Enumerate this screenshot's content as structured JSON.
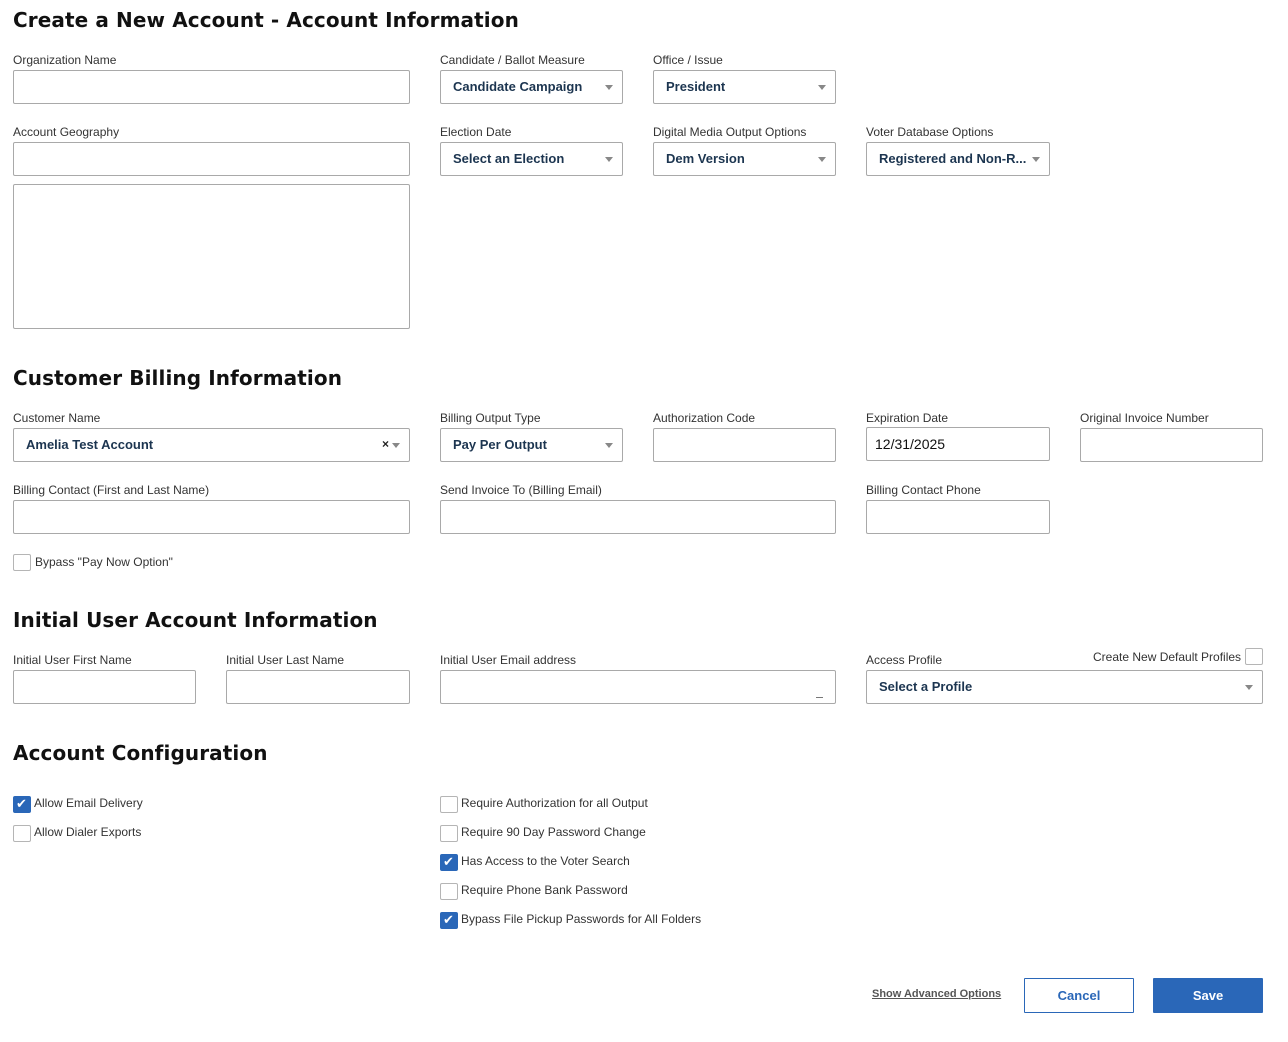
{
  "account_info": {
    "title": "Create a New Account - Account Information",
    "org_name_label": "Organization Name",
    "org_name_value": "",
    "candidate_label": "Candidate / Ballot Measure",
    "candidate_value": "Candidate Campaign",
    "office_label": "Office / Issue",
    "office_value": "President",
    "geography_label": "Account Geography",
    "geography_value": "",
    "election_date_label": "Election Date",
    "election_date_value": "Select an Election",
    "digital_media_label": "Digital Media Output Options",
    "digital_media_value": "Dem Version",
    "voter_db_label": "Voter Database Options",
    "voter_db_value": "Registered and Non-R..."
  },
  "billing": {
    "title": "Customer Billing Information",
    "customer_name_label": "Customer Name",
    "customer_name_value": "Amelia Test Account",
    "clear_glyph": "×",
    "output_type_label": "Billing Output Type",
    "output_type_value": "Pay Per Output",
    "auth_code_label": "Authorization Code",
    "auth_code_value": "",
    "expiration_label": "Expiration Date",
    "expiration_value": "12/31/2025",
    "invoice_number_label": "Original Invoice Number",
    "invoice_number_value": "",
    "contact_label": "Billing Contact (First and Last Name)",
    "contact_value": "",
    "send_invoice_label": "Send Invoice To (Billing Email)",
    "send_invoice_value": "",
    "phone_label": "Billing Contact Phone",
    "phone_value": "",
    "bypass_label": "Bypass \"Pay Now Option\"",
    "bypass_checked": false
  },
  "initial_user": {
    "title": "Initial User Account Information",
    "first_name_label": "Initial User First Name",
    "first_name_value": "",
    "last_name_label": "Initial User Last Name",
    "last_name_value": "",
    "email_label": "Initial User Email address",
    "email_value": "",
    "access_profile_label": "Access Profile",
    "access_profile_value": "Select a Profile",
    "default_profiles_label": "Create New Default Profiles",
    "default_profiles_checked": false
  },
  "config": {
    "title": "Account Configuration",
    "left_options": [
      {
        "label": "Allow Email Delivery",
        "checked": true
      },
      {
        "label": "Allow Dialer Exports",
        "checked": false
      }
    ],
    "right_options": [
      {
        "label": "Require Authorization for all Output",
        "checked": false
      },
      {
        "label": "Require 90 Day Password Change",
        "checked": false
      },
      {
        "label": "Has Access to the Voter Search",
        "checked": true
      },
      {
        "label": "Require Phone Bank Password",
        "checked": false
      },
      {
        "label": "Bypass File Pickup Passwords for All Folders",
        "checked": true
      }
    ]
  },
  "actions": {
    "advanced_label": "Show Advanced Options",
    "cancel_label": "Cancel",
    "save_label": "Save"
  },
  "colors": {
    "accent": "#2a67b8",
    "select_text": "#1c3550",
    "border": "#a9a9a9"
  }
}
